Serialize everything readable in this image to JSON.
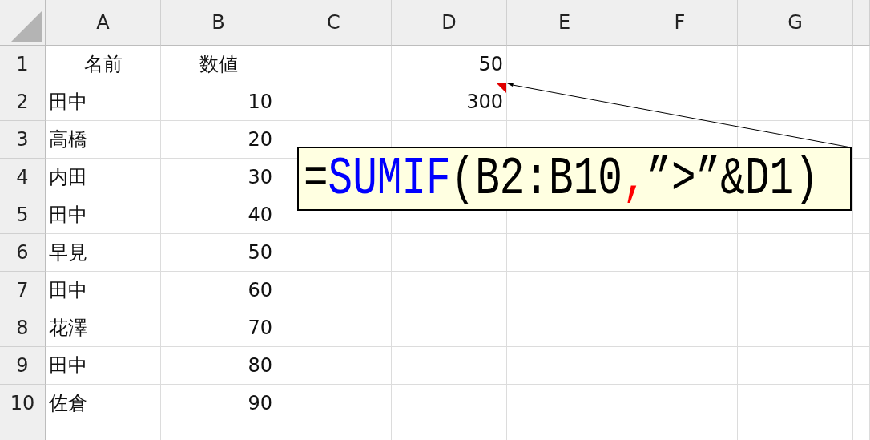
{
  "columns": [
    "A",
    "B",
    "C",
    "D",
    "E",
    "F",
    "G"
  ],
  "rows": [
    {
      "label": "1",
      "cells": {
        "A": {
          "kind": "heading",
          "text": "名前",
          "has_comment": false
        },
        "B": {
          "kind": "heading",
          "text": "数値",
          "has_comment": false
        },
        "D": {
          "kind": "number",
          "text": "50",
          "has_comment": false
        }
      }
    },
    {
      "label": "2",
      "cells": {
        "A": {
          "kind": "text",
          "text": "田中",
          "has_comment": false
        },
        "B": {
          "kind": "number",
          "text": "10",
          "has_comment": false
        },
        "D": {
          "kind": "number",
          "text": "300",
          "has_comment": true
        }
      }
    },
    {
      "label": "3",
      "cells": {
        "A": {
          "kind": "text",
          "text": "高橋",
          "has_comment": false
        },
        "B": {
          "kind": "number",
          "text": "20",
          "has_comment": false
        }
      }
    },
    {
      "label": "4",
      "cells": {
        "A": {
          "kind": "text",
          "text": "内田",
          "has_comment": false
        },
        "B": {
          "kind": "number",
          "text": "30",
          "has_comment": false
        }
      }
    },
    {
      "label": "5",
      "cells": {
        "A": {
          "kind": "text",
          "text": "田中",
          "has_comment": false
        },
        "B": {
          "kind": "number",
          "text": "40",
          "has_comment": false
        }
      }
    },
    {
      "label": "6",
      "cells": {
        "A": {
          "kind": "text",
          "text": "早見",
          "has_comment": false
        },
        "B": {
          "kind": "number",
          "text": "50",
          "has_comment": false
        }
      }
    },
    {
      "label": "7",
      "cells": {
        "A": {
          "kind": "text",
          "text": "田中",
          "has_comment": false
        },
        "B": {
          "kind": "number",
          "text": "60",
          "has_comment": false
        }
      }
    },
    {
      "label": "8",
      "cells": {
        "A": {
          "kind": "text",
          "text": "花澤",
          "has_comment": false
        },
        "B": {
          "kind": "number",
          "text": "70",
          "has_comment": false
        }
      }
    },
    {
      "label": "9",
      "cells": {
        "A": {
          "kind": "text",
          "text": "田中",
          "has_comment": false
        },
        "B": {
          "kind": "number",
          "text": "80",
          "has_comment": false
        }
      }
    },
    {
      "label": "10",
      "cells": {
        "A": {
          "kind": "text",
          "text": "佐倉",
          "has_comment": false
        },
        "B": {
          "kind": "number",
          "text": "90",
          "has_comment": false
        }
      }
    }
  ],
  "comment": {
    "segments": [
      {
        "text": "=",
        "color": "#000000"
      },
      {
        "text": "SUMIF",
        "color": "#0000ff"
      },
      {
        "text": "(B2:B10",
        "color": "#000000"
      },
      {
        "text": ",",
        "color": "#ff0000"
      },
      {
        "text": "”>”&D1)",
        "color": "#000000"
      }
    ]
  }
}
